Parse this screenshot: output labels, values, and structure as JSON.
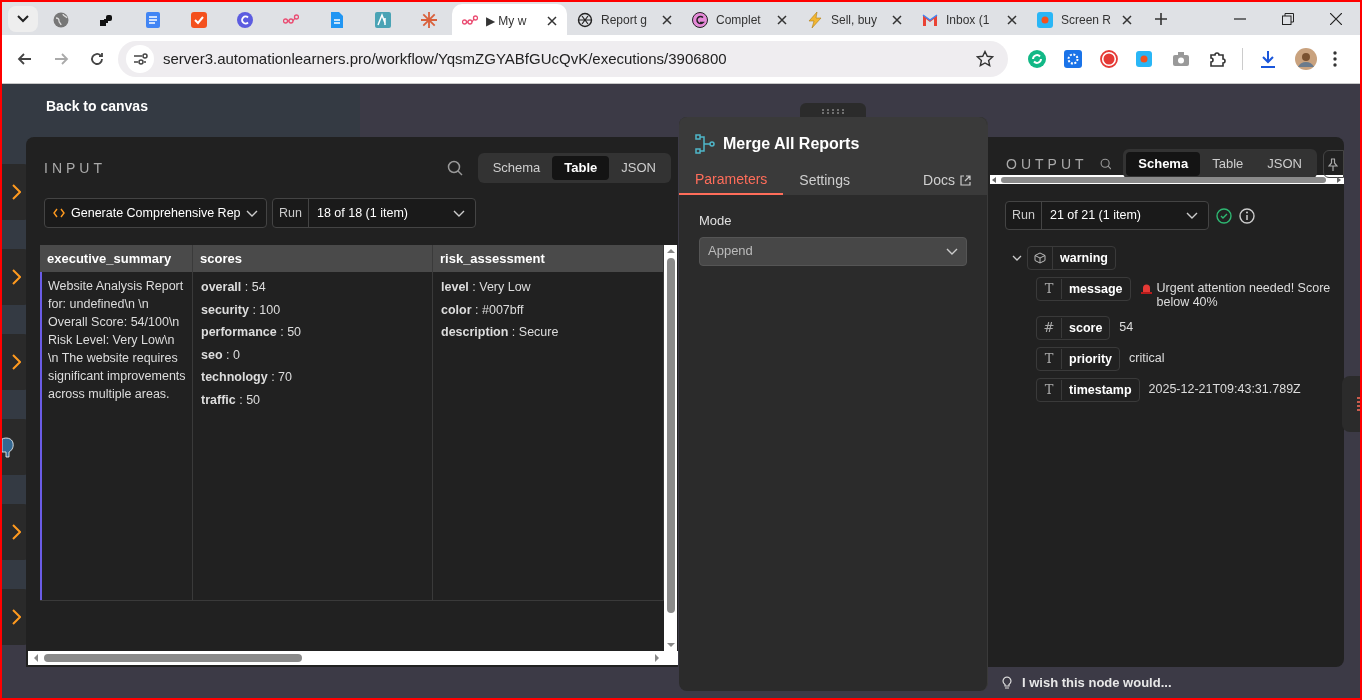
{
  "browser": {
    "tabs": [
      {
        "kind": "globe",
        "selected": false
      },
      {
        "kind": "blocks",
        "selected": false
      },
      {
        "kind": "doc-lines",
        "selected": false
      },
      {
        "kind": "orange-check",
        "selected": false
      },
      {
        "kind": "purple-circle",
        "selected": false
      },
      {
        "kind": "nodes",
        "selected": false
      },
      {
        "kind": "blue-doc",
        "selected": false
      },
      {
        "kind": "teal-square",
        "selected": false
      },
      {
        "kind": "starburst",
        "selected": false
      },
      {
        "kind": "nodes",
        "title": "▶ My w",
        "selected": true
      },
      {
        "kind": "spiral",
        "title": "Report g",
        "selected": false
      },
      {
        "kind": "pink-circle",
        "title": "Complet",
        "selected": false
      },
      {
        "kind": "bolt",
        "title": "Sell, buy",
        "selected": false
      },
      {
        "kind": "mail",
        "title": "Inbox (1",
        "selected": false
      },
      {
        "kind": "record",
        "title": "Screen R",
        "selected": false
      }
    ],
    "address": "server3.automationlearners.pro/workflow/YqsmZGYABfGUcQvK/executions/3906800"
  },
  "back_link": "Back to canvas",
  "input_panel": {
    "title": "INPUT",
    "view_tabs": [
      {
        "label": "Schema",
        "selected": false
      },
      {
        "label": "Table",
        "selected": true
      },
      {
        "label": "JSON",
        "selected": false
      }
    ],
    "node_select": "Generate Comprehensive Rep",
    "run_label": "Run",
    "run_select": "18 of 18 (1 item)",
    "table": {
      "columns": [
        "executive_summary",
        "scores",
        "risk_assessment"
      ],
      "rows": [
        {
          "executive_summary": "Website Analysis Report for: undefined\\n \\n Overall Score: 54/100\\n Risk Level: Very Low\\n \\n The website requires significant improvements across multiple areas.",
          "scores": [
            "**overall** : 54",
            "**security** : 100",
            "**performance** : 50",
            "**seo** : 0",
            "**technology** : 70",
            "**traffic** : 50"
          ],
          "risk_assessment": [
            "**level** : Very Low",
            "**color** : #007bff",
            "**description** : Secure"
          ]
        }
      ]
    }
  },
  "node_panel": {
    "title": "Merge All Reports",
    "tabs": [
      {
        "label": "Parameters",
        "selected": true
      },
      {
        "label": "Settings",
        "selected": false
      },
      {
        "label": "Docs",
        "selected": false
      }
    ],
    "parameters": [
      {
        "label": "Mode",
        "value": "Append"
      }
    ]
  },
  "output_panel": {
    "title": "OUTPUT",
    "view_tabs": [
      {
        "label": "Schema",
        "selected": true
      },
      {
        "label": "Table",
        "selected": false
      },
      {
        "label": "JSON",
        "selected": false
      }
    ],
    "run_label": "Run",
    "run_select": "21 of 21 (1 item)",
    "schema": [
      {
        "name": "warning",
        "kind": "object",
        "expanded": true,
        "children": [
          {
            "name": "message",
            "type_icon": "T",
            "value": "Urgent attention needed! Score below 40%",
            "alert": true
          },
          {
            "name": "score",
            "type_icon": "#",
            "value": "54",
            "alert": false
          },
          {
            "name": "priority",
            "type_icon": "T",
            "value": "critical",
            "alert": false
          },
          {
            "name": "timestamp",
            "type_icon": "T",
            "value": "2025-12-21T09:43:31.789Z",
            "alert": false
          }
        ]
      }
    ]
  },
  "feedback": "I wish this node would..."
}
